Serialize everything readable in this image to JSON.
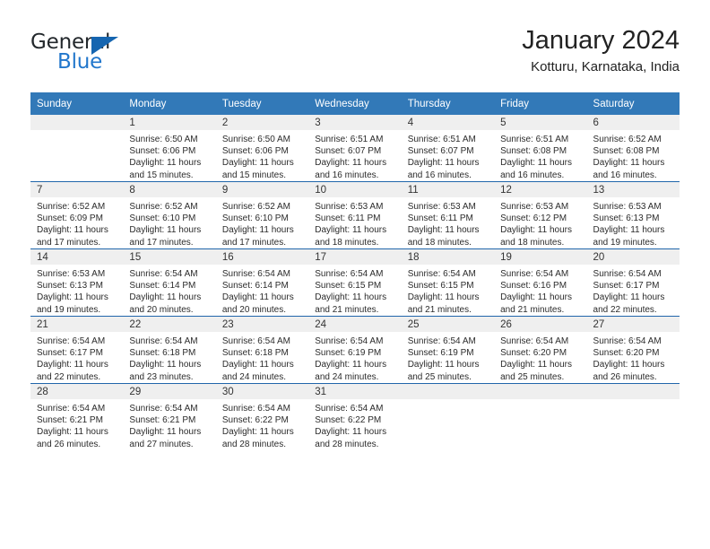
{
  "brand": {
    "name_top": "General",
    "name_bottom": "Blue",
    "accent_color": "#1565b0",
    "blue_text_color": "#2277cc"
  },
  "header": {
    "title": "January 2024",
    "subtitle": "Kotturu, Karnataka, India"
  },
  "theme": {
    "header_bg": "#3279b8",
    "row_divider": "#2166ab",
    "daynum_band_bg": "#efefef"
  },
  "weekdays": [
    "Sunday",
    "Monday",
    "Tuesday",
    "Wednesday",
    "Thursday",
    "Friday",
    "Saturday"
  ],
  "weeks": [
    [
      {
        "day": "",
        "sunrise": "",
        "sunset": "",
        "daylight": "",
        "empty": true
      },
      {
        "day": "1",
        "sunrise": "Sunrise: 6:50 AM",
        "sunset": "Sunset: 6:06 PM",
        "daylight": "Daylight: 11 hours and 15 minutes."
      },
      {
        "day": "2",
        "sunrise": "Sunrise: 6:50 AM",
        "sunset": "Sunset: 6:06 PM",
        "daylight": "Daylight: 11 hours and 15 minutes."
      },
      {
        "day": "3",
        "sunrise": "Sunrise: 6:51 AM",
        "sunset": "Sunset: 6:07 PM",
        "daylight": "Daylight: 11 hours and 16 minutes."
      },
      {
        "day": "4",
        "sunrise": "Sunrise: 6:51 AM",
        "sunset": "Sunset: 6:07 PM",
        "daylight": "Daylight: 11 hours and 16 minutes."
      },
      {
        "day": "5",
        "sunrise": "Sunrise: 6:51 AM",
        "sunset": "Sunset: 6:08 PM",
        "daylight": "Daylight: 11 hours and 16 minutes."
      },
      {
        "day": "6",
        "sunrise": "Sunrise: 6:52 AM",
        "sunset": "Sunset: 6:08 PM",
        "daylight": "Daylight: 11 hours and 16 minutes."
      }
    ],
    [
      {
        "day": "7",
        "sunrise": "Sunrise: 6:52 AM",
        "sunset": "Sunset: 6:09 PM",
        "daylight": "Daylight: 11 hours and 17 minutes."
      },
      {
        "day": "8",
        "sunrise": "Sunrise: 6:52 AM",
        "sunset": "Sunset: 6:10 PM",
        "daylight": "Daylight: 11 hours and 17 minutes."
      },
      {
        "day": "9",
        "sunrise": "Sunrise: 6:52 AM",
        "sunset": "Sunset: 6:10 PM",
        "daylight": "Daylight: 11 hours and 17 minutes."
      },
      {
        "day": "10",
        "sunrise": "Sunrise: 6:53 AM",
        "sunset": "Sunset: 6:11 PM",
        "daylight": "Daylight: 11 hours and 18 minutes."
      },
      {
        "day": "11",
        "sunrise": "Sunrise: 6:53 AM",
        "sunset": "Sunset: 6:11 PM",
        "daylight": "Daylight: 11 hours and 18 minutes."
      },
      {
        "day": "12",
        "sunrise": "Sunrise: 6:53 AM",
        "sunset": "Sunset: 6:12 PM",
        "daylight": "Daylight: 11 hours and 18 minutes."
      },
      {
        "day": "13",
        "sunrise": "Sunrise: 6:53 AM",
        "sunset": "Sunset: 6:13 PM",
        "daylight": "Daylight: 11 hours and 19 minutes."
      }
    ],
    [
      {
        "day": "14",
        "sunrise": "Sunrise: 6:53 AM",
        "sunset": "Sunset: 6:13 PM",
        "daylight": "Daylight: 11 hours and 19 minutes."
      },
      {
        "day": "15",
        "sunrise": "Sunrise: 6:54 AM",
        "sunset": "Sunset: 6:14 PM",
        "daylight": "Daylight: 11 hours and 20 minutes."
      },
      {
        "day": "16",
        "sunrise": "Sunrise: 6:54 AM",
        "sunset": "Sunset: 6:14 PM",
        "daylight": "Daylight: 11 hours and 20 minutes."
      },
      {
        "day": "17",
        "sunrise": "Sunrise: 6:54 AM",
        "sunset": "Sunset: 6:15 PM",
        "daylight": "Daylight: 11 hours and 21 minutes."
      },
      {
        "day": "18",
        "sunrise": "Sunrise: 6:54 AM",
        "sunset": "Sunset: 6:15 PM",
        "daylight": "Daylight: 11 hours and 21 minutes."
      },
      {
        "day": "19",
        "sunrise": "Sunrise: 6:54 AM",
        "sunset": "Sunset: 6:16 PM",
        "daylight": "Daylight: 11 hours and 21 minutes."
      },
      {
        "day": "20",
        "sunrise": "Sunrise: 6:54 AM",
        "sunset": "Sunset: 6:17 PM",
        "daylight": "Daylight: 11 hours and 22 minutes."
      }
    ],
    [
      {
        "day": "21",
        "sunrise": "Sunrise: 6:54 AM",
        "sunset": "Sunset: 6:17 PM",
        "daylight": "Daylight: 11 hours and 22 minutes."
      },
      {
        "day": "22",
        "sunrise": "Sunrise: 6:54 AM",
        "sunset": "Sunset: 6:18 PM",
        "daylight": "Daylight: 11 hours and 23 minutes."
      },
      {
        "day": "23",
        "sunrise": "Sunrise: 6:54 AM",
        "sunset": "Sunset: 6:18 PM",
        "daylight": "Daylight: 11 hours and 24 minutes."
      },
      {
        "day": "24",
        "sunrise": "Sunrise: 6:54 AM",
        "sunset": "Sunset: 6:19 PM",
        "daylight": "Daylight: 11 hours and 24 minutes."
      },
      {
        "day": "25",
        "sunrise": "Sunrise: 6:54 AM",
        "sunset": "Sunset: 6:19 PM",
        "daylight": "Daylight: 11 hours and 25 minutes."
      },
      {
        "day": "26",
        "sunrise": "Sunrise: 6:54 AM",
        "sunset": "Sunset: 6:20 PM",
        "daylight": "Daylight: 11 hours and 25 minutes."
      },
      {
        "day": "27",
        "sunrise": "Sunrise: 6:54 AM",
        "sunset": "Sunset: 6:20 PM",
        "daylight": "Daylight: 11 hours and 26 minutes."
      }
    ],
    [
      {
        "day": "28",
        "sunrise": "Sunrise: 6:54 AM",
        "sunset": "Sunset: 6:21 PM",
        "daylight": "Daylight: 11 hours and 26 minutes."
      },
      {
        "day": "29",
        "sunrise": "Sunrise: 6:54 AM",
        "sunset": "Sunset: 6:21 PM",
        "daylight": "Daylight: 11 hours and 27 minutes."
      },
      {
        "day": "30",
        "sunrise": "Sunrise: 6:54 AM",
        "sunset": "Sunset: 6:22 PM",
        "daylight": "Daylight: 11 hours and 28 minutes."
      },
      {
        "day": "31",
        "sunrise": "Sunrise: 6:54 AM",
        "sunset": "Sunset: 6:22 PM",
        "daylight": "Daylight: 11 hours and 28 minutes."
      },
      {
        "day": "",
        "sunrise": "",
        "sunset": "",
        "daylight": "",
        "empty": true
      },
      {
        "day": "",
        "sunrise": "",
        "sunset": "",
        "daylight": "",
        "empty": true
      },
      {
        "day": "",
        "sunrise": "",
        "sunset": "",
        "daylight": "",
        "empty": true
      }
    ]
  ]
}
